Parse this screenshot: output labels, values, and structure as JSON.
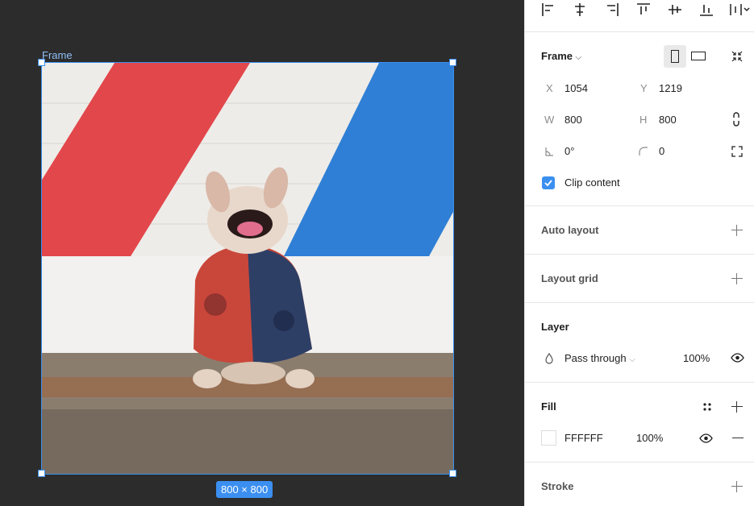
{
  "canvas": {
    "frame_label": "Frame",
    "size_badge": "800 × 800"
  },
  "panel": {
    "frame": {
      "title": "Frame",
      "x_label": "X",
      "x_value": "1054",
      "y_label": "Y",
      "y_value": "1219",
      "w_label": "W",
      "w_value": "800",
      "h_label": "H",
      "h_value": "800",
      "rotation": "0°",
      "radius": "0",
      "clip_label": "Clip content"
    },
    "auto_layout": {
      "title": "Auto layout"
    },
    "layout_grid": {
      "title": "Layout grid"
    },
    "layer": {
      "title": "Layer",
      "blend": "Pass through",
      "opacity": "100%"
    },
    "fill": {
      "title": "Fill",
      "hex": "FFFFFF",
      "opacity": "100%"
    },
    "stroke": {
      "title": "Stroke"
    }
  },
  "colors": {
    "accent": "#3b8ff0",
    "canvas_bg": "#2c2c2c",
    "panel_bg": "#ffffff"
  }
}
